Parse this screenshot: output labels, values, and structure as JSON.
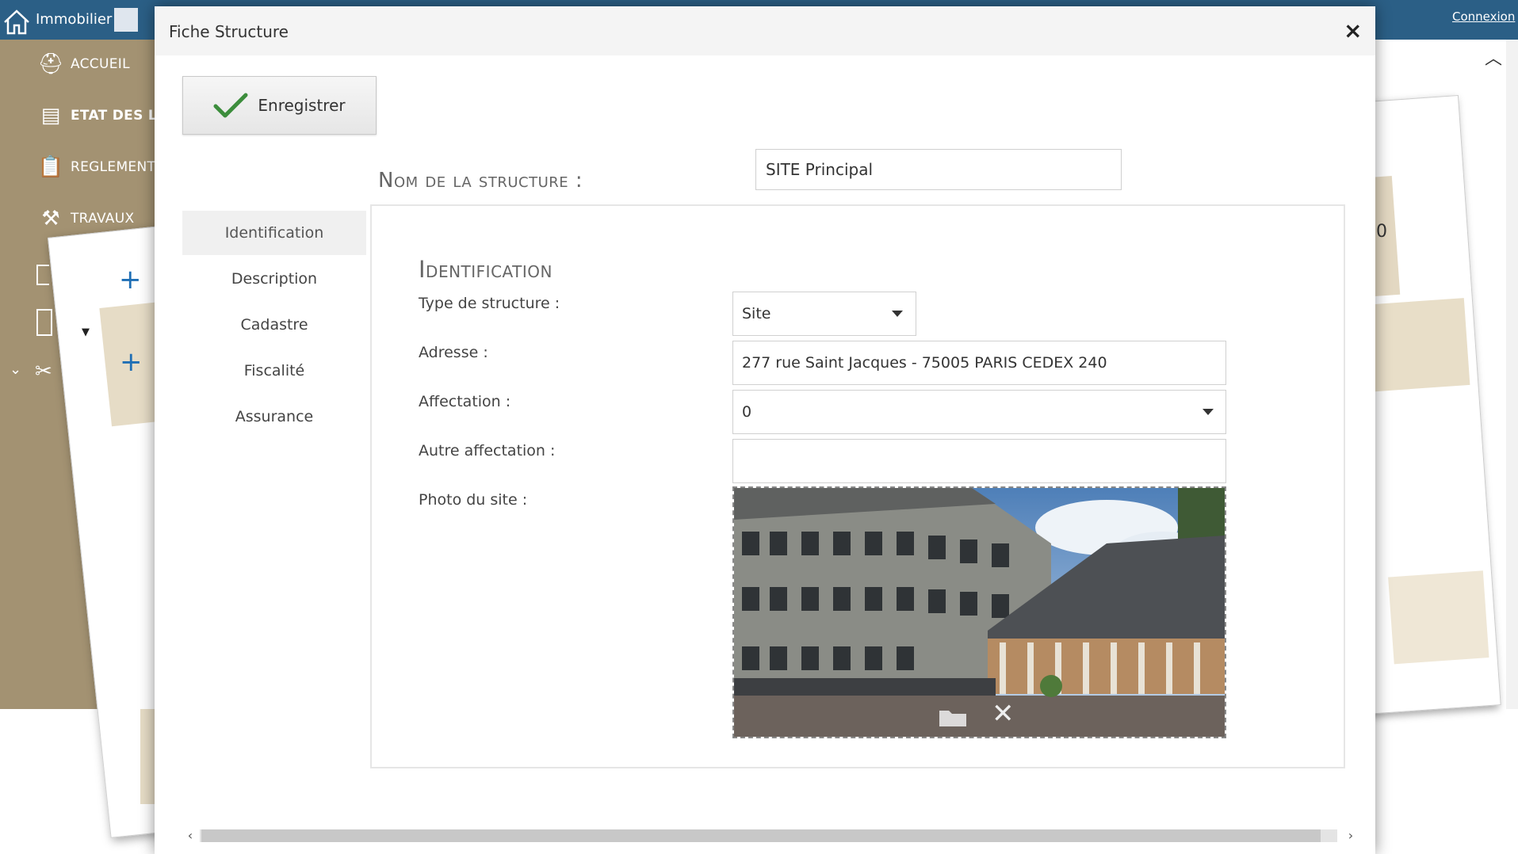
{
  "app": {
    "title": "Immobilier",
    "connexion": "Connexion",
    "nav": [
      {
        "label": "ACCUEIL",
        "icon": "helmet-icon"
      },
      {
        "label": "ETAT DES LI",
        "icon": "cabinet-icon"
      },
      {
        "label": "REGLEMENT",
        "icon": "clipboard-icon"
      },
      {
        "label": "TRAVAUX",
        "icon": "crane-icon"
      }
    ],
    "right_fragment": "0"
  },
  "modal": {
    "title": "Fiche Structure",
    "close": "×",
    "save_label": "Enregistrer",
    "structure_label": "Nom de la structure :",
    "structure_value": "SITE Principal",
    "tabs": [
      {
        "label": "Identification",
        "active": true
      },
      {
        "label": "Description",
        "active": false
      },
      {
        "label": "Cadastre",
        "active": false
      },
      {
        "label": "Fiscalité",
        "active": false
      },
      {
        "label": "Assurance",
        "active": false
      }
    ],
    "section_title": "Identification",
    "fields": {
      "type_label": "Type de structure :",
      "type_value": "Site",
      "adresse_label": "Adresse :",
      "adresse_value": "277 rue Saint Jacques - 75005 PARIS CEDEX 240",
      "affectation_label": "Affectation :",
      "affectation_value": "0",
      "autre_label": "Autre affectation :",
      "autre_value": "",
      "photo_label": "Photo du site :"
    }
  },
  "colors": {
    "topbar": "#2b5f86",
    "sidebar": "#a39272",
    "check": "#3c8d3c",
    "plus": "#1f6fb5"
  }
}
